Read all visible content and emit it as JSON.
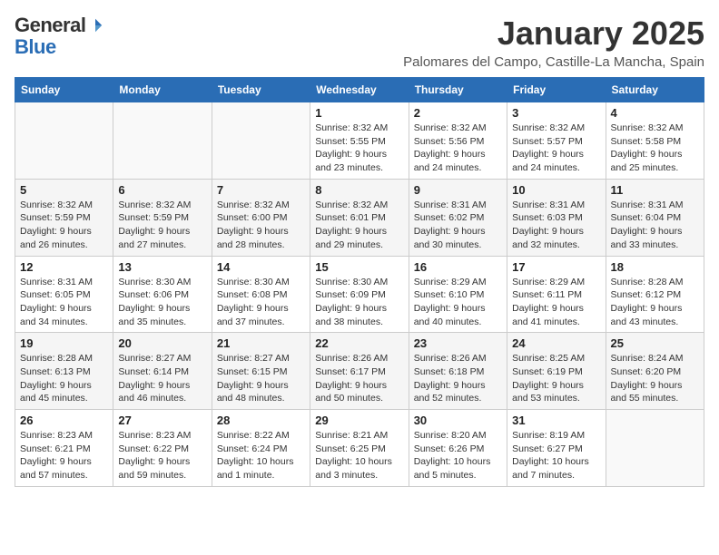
{
  "header": {
    "logo_general": "General",
    "logo_blue": "Blue",
    "title": "January 2025",
    "subtitle": "Palomares del Campo, Castille-La Mancha, Spain"
  },
  "weekdays": [
    "Sunday",
    "Monday",
    "Tuesday",
    "Wednesday",
    "Thursday",
    "Friday",
    "Saturday"
  ],
  "weeks": [
    [
      {
        "day": "",
        "info": ""
      },
      {
        "day": "",
        "info": ""
      },
      {
        "day": "",
        "info": ""
      },
      {
        "day": "1",
        "info": "Sunrise: 8:32 AM\nSunset: 5:55 PM\nDaylight: 9 hours and 23 minutes."
      },
      {
        "day": "2",
        "info": "Sunrise: 8:32 AM\nSunset: 5:56 PM\nDaylight: 9 hours and 24 minutes."
      },
      {
        "day": "3",
        "info": "Sunrise: 8:32 AM\nSunset: 5:57 PM\nDaylight: 9 hours and 24 minutes."
      },
      {
        "day": "4",
        "info": "Sunrise: 8:32 AM\nSunset: 5:58 PM\nDaylight: 9 hours and 25 minutes."
      }
    ],
    [
      {
        "day": "5",
        "info": "Sunrise: 8:32 AM\nSunset: 5:59 PM\nDaylight: 9 hours and 26 minutes."
      },
      {
        "day": "6",
        "info": "Sunrise: 8:32 AM\nSunset: 5:59 PM\nDaylight: 9 hours and 27 minutes."
      },
      {
        "day": "7",
        "info": "Sunrise: 8:32 AM\nSunset: 6:00 PM\nDaylight: 9 hours and 28 minutes."
      },
      {
        "day": "8",
        "info": "Sunrise: 8:32 AM\nSunset: 6:01 PM\nDaylight: 9 hours and 29 minutes."
      },
      {
        "day": "9",
        "info": "Sunrise: 8:31 AM\nSunset: 6:02 PM\nDaylight: 9 hours and 30 minutes."
      },
      {
        "day": "10",
        "info": "Sunrise: 8:31 AM\nSunset: 6:03 PM\nDaylight: 9 hours and 32 minutes."
      },
      {
        "day": "11",
        "info": "Sunrise: 8:31 AM\nSunset: 6:04 PM\nDaylight: 9 hours and 33 minutes."
      }
    ],
    [
      {
        "day": "12",
        "info": "Sunrise: 8:31 AM\nSunset: 6:05 PM\nDaylight: 9 hours and 34 minutes."
      },
      {
        "day": "13",
        "info": "Sunrise: 8:30 AM\nSunset: 6:06 PM\nDaylight: 9 hours and 35 minutes."
      },
      {
        "day": "14",
        "info": "Sunrise: 8:30 AM\nSunset: 6:08 PM\nDaylight: 9 hours and 37 minutes."
      },
      {
        "day": "15",
        "info": "Sunrise: 8:30 AM\nSunset: 6:09 PM\nDaylight: 9 hours and 38 minutes."
      },
      {
        "day": "16",
        "info": "Sunrise: 8:29 AM\nSunset: 6:10 PM\nDaylight: 9 hours and 40 minutes."
      },
      {
        "day": "17",
        "info": "Sunrise: 8:29 AM\nSunset: 6:11 PM\nDaylight: 9 hours and 41 minutes."
      },
      {
        "day": "18",
        "info": "Sunrise: 8:28 AM\nSunset: 6:12 PM\nDaylight: 9 hours and 43 minutes."
      }
    ],
    [
      {
        "day": "19",
        "info": "Sunrise: 8:28 AM\nSunset: 6:13 PM\nDaylight: 9 hours and 45 minutes."
      },
      {
        "day": "20",
        "info": "Sunrise: 8:27 AM\nSunset: 6:14 PM\nDaylight: 9 hours and 46 minutes."
      },
      {
        "day": "21",
        "info": "Sunrise: 8:27 AM\nSunset: 6:15 PM\nDaylight: 9 hours and 48 minutes."
      },
      {
        "day": "22",
        "info": "Sunrise: 8:26 AM\nSunset: 6:17 PM\nDaylight: 9 hours and 50 minutes."
      },
      {
        "day": "23",
        "info": "Sunrise: 8:26 AM\nSunset: 6:18 PM\nDaylight: 9 hours and 52 minutes."
      },
      {
        "day": "24",
        "info": "Sunrise: 8:25 AM\nSunset: 6:19 PM\nDaylight: 9 hours and 53 minutes."
      },
      {
        "day": "25",
        "info": "Sunrise: 8:24 AM\nSunset: 6:20 PM\nDaylight: 9 hours and 55 minutes."
      }
    ],
    [
      {
        "day": "26",
        "info": "Sunrise: 8:23 AM\nSunset: 6:21 PM\nDaylight: 9 hours and 57 minutes."
      },
      {
        "day": "27",
        "info": "Sunrise: 8:23 AM\nSunset: 6:22 PM\nDaylight: 9 hours and 59 minutes."
      },
      {
        "day": "28",
        "info": "Sunrise: 8:22 AM\nSunset: 6:24 PM\nDaylight: 10 hours and 1 minute."
      },
      {
        "day": "29",
        "info": "Sunrise: 8:21 AM\nSunset: 6:25 PM\nDaylight: 10 hours and 3 minutes."
      },
      {
        "day": "30",
        "info": "Sunrise: 8:20 AM\nSunset: 6:26 PM\nDaylight: 10 hours and 5 minutes."
      },
      {
        "day": "31",
        "info": "Sunrise: 8:19 AM\nSunset: 6:27 PM\nDaylight: 10 hours and 7 minutes."
      },
      {
        "day": "",
        "info": ""
      }
    ]
  ]
}
